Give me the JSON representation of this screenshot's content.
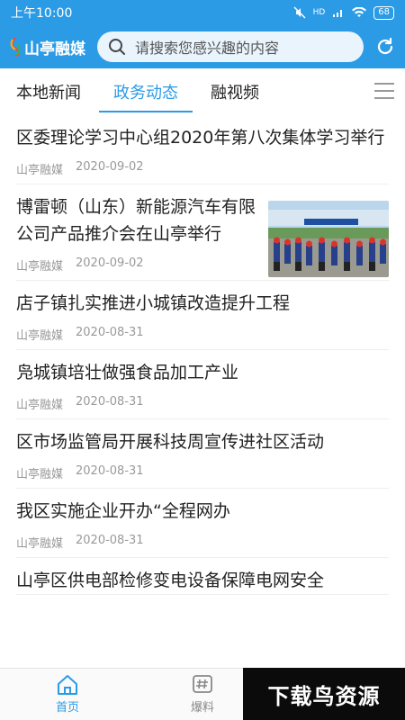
{
  "status_bar": {
    "time": "上午10:00",
    "signal": "HD",
    "battery": "68"
  },
  "header": {
    "logo_text": "山亭融媒",
    "search_placeholder": "请搜索您感兴趣的内容"
  },
  "tabs": [
    {
      "label": "本地新闻",
      "active": false
    },
    {
      "label": "政务动态",
      "active": true
    },
    {
      "label": "融视频",
      "active": false
    }
  ],
  "news": [
    {
      "title": "区委理论学习中心组2020年第八次集体学习举行",
      "source": "山亭融媒",
      "date": "2020-09-02"
    },
    {
      "title": "博雷顿（山东）新能源汽车有限公司产品推介会在山亭举行",
      "source": "山亭融媒",
      "date": "2020-09-02"
    },
    {
      "title": "店子镇扎实推进小城镇改造提升工程",
      "source": "山亭融媒",
      "date": "2020-08-31"
    },
    {
      "title": "凫城镇培壮做强食品加工产业",
      "source": "山亭融媒",
      "date": "2020-08-31"
    },
    {
      "title": "区市场监管局开展科技周宣传进社区活动",
      "source": "山亭融媒",
      "date": "2020-08-31"
    },
    {
      "title": "我区实施企业开办“全程网办",
      "source": "山亭融媒",
      "date": "2020-08-31"
    },
    {
      "title": "山亭区供电部检修变电设备保障电网安全",
      "source": "",
      "date": ""
    }
  ],
  "bottom_nav": [
    {
      "label": "首页",
      "icon": "home-icon",
      "active": true
    },
    {
      "label": "爆料",
      "icon": "hashtag-icon",
      "active": false
    }
  ],
  "watermark": "下载鸟资源",
  "colors": {
    "primary": "#2b9be6",
    "text": "#222222",
    "meta": "#999999"
  }
}
